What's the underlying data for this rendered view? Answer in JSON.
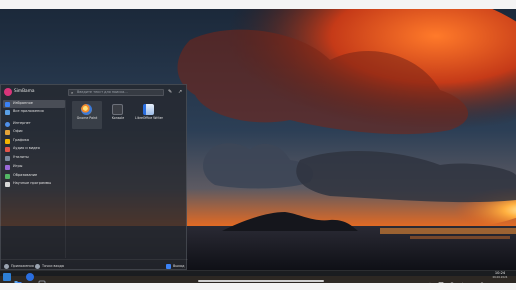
{
  "launcher": {
    "username": "SimBama",
    "search_placeholder": "Введите текст для поиска…",
    "icons": {
      "pin": "pin-icon",
      "settings": "settings-icon"
    },
    "categories": [
      {
        "label": "Избранное",
        "icon": "star-icon",
        "color": "#3b82f6",
        "active": true
      },
      {
        "label": "Все приложения",
        "icon": "grid-icon",
        "color": "#5aa0e6"
      },
      {
        "label": "Интернет",
        "icon": "globe-icon",
        "color": "#4f8fe8"
      },
      {
        "label": "Офис",
        "icon": "briefcase-icon",
        "color": "#e3a33a"
      },
      {
        "label": "Графика",
        "icon": "image-icon",
        "color": "#f4b400"
      },
      {
        "label": "Аудио и видео",
        "icon": "media-icon",
        "color": "#e4554a"
      },
      {
        "label": "Утилиты",
        "icon": "tools-icon",
        "color": "#7d8ba0"
      },
      {
        "label": "Игры",
        "icon": "gamepad-icon",
        "color": "#9b6ad9"
      },
      {
        "label": "Образование",
        "icon": "graduation-icon",
        "color": "#54b865"
      },
      {
        "label": "Научные программы",
        "icon": "flask-icon",
        "color": "#d8d8d8"
      }
    ],
    "apps": [
      {
        "label": "Gnome Paint",
        "icon": "paint-icon",
        "selected": true
      },
      {
        "label": "Konsole",
        "icon": "terminal-icon"
      },
      {
        "label": "LibreOffice Writer",
        "icon": "writer-icon"
      }
    ],
    "footer": {
      "sleep_label": "Приложения",
      "power_label": "Точки входа",
      "logout_label": "Выход"
    }
  },
  "taskbar": {
    "items": [
      "launcher-icon",
      "files-icon",
      "browser-icon",
      "app-icon"
    ],
    "tray_icons": [
      "updates-icon",
      "clipboard-icon",
      "network-icon",
      "volume-icon",
      "battery-icon",
      "notifications-icon"
    ],
    "clock_time": "10:24",
    "clock_date": "06.06.2024"
  },
  "colors": {
    "accent": "#3b82f6",
    "launcher_bg": "#26282e",
    "taskbar_bg": "#1c1e22"
  }
}
